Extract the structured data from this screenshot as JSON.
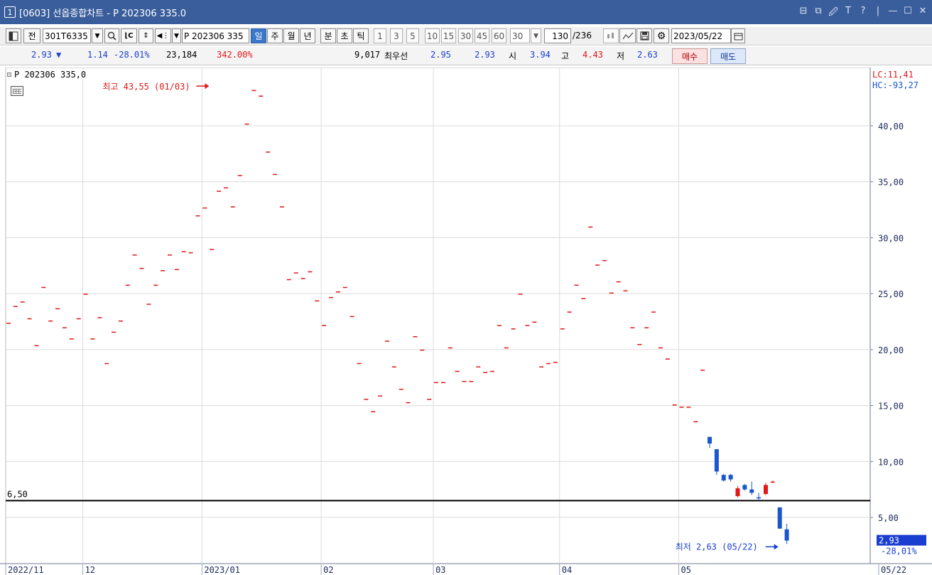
{
  "window": {
    "number": "1",
    "title": "[0603] 선옵종합차트 - P 202306 335.0",
    "controls": [
      "⊟",
      "⧉",
      "🖉",
      "T",
      "?",
      "|",
      "—",
      "☐",
      "✕"
    ]
  },
  "toolbar": {
    "layout_icon": "layout-icon",
    "prev_label": "전",
    "code_value": "301T6335",
    "search_icon": "search-icon",
    "chart_type_icon": "candle-type-icon",
    "updown_icon": "updown-icon",
    "sound_icon": "sound-icon",
    "name_value": "P 202306 335",
    "periods": [
      "일",
      "주",
      "월",
      "년",
      "분",
      "초",
      "틱"
    ],
    "selected_period": "일",
    "intervals": [
      "1",
      "3",
      "5",
      "10",
      "15",
      "30",
      "45",
      "60"
    ],
    "interval_value": "30",
    "count_value": "130",
    "count_total": "/236",
    "date_value": "2023/05/22",
    "tool_icons": [
      "compare-icon",
      "draw-icon",
      "save-icon",
      "gear-icon"
    ],
    "calendar_icon": "calendar-icon"
  },
  "info": {
    "price": "2.93",
    "price_arrow": "▼",
    "change": "1.14",
    "change_pct": "-28.01%",
    "volume": "23,184",
    "volume_pct": "342.00%",
    "open_interest": "9,017",
    "best_label": "최우선",
    "best_ask": "2.95",
    "best_bid": "2.93",
    "open_label": "시",
    "open": "3.94",
    "high_label": "고",
    "high": "4.43",
    "low_label": "저",
    "low": "2.63",
    "buy_label": "매수",
    "sell_label": "매도"
  },
  "chart_data": {
    "type": "candlestick",
    "title": "P 202306 335,0",
    "ylim": [
      0,
      45
    ],
    "y_ticks": [
      "40,00",
      "35,00",
      "30,00",
      "25,00",
      "20,00",
      "15,00",
      "10,00",
      "5,00"
    ],
    "y_tick_values": [
      40,
      35,
      30,
      25,
      20,
      15,
      10,
      5
    ],
    "x_ticks": [
      {
        "label": "2022/11",
        "index": 0
      },
      {
        "label": "12",
        "index": 11
      },
      {
        "label": "2023/01",
        "index": 28
      },
      {
        "label": "02",
        "index": 45
      },
      {
        "label": "03",
        "index": 61
      },
      {
        "label": "04",
        "index": 79
      },
      {
        "label": "05",
        "index": 96
      },
      {
        "label": "05/22",
        "index": 110
      }
    ],
    "hline": {
      "value": 6.5,
      "label": "6,50"
    },
    "lc_label": "LC:11,41",
    "hc_label": "HC:-93,27",
    "current": {
      "value": 2.93,
      "label": "2,93",
      "pct": "-28,01%"
    },
    "max_annotation": {
      "text": "최고 43,55 (01/03)",
      "index": 28,
      "value": 43.55
    },
    "min_annotation": {
      "text": "최저 2,63 (05/22)",
      "index": 110,
      "value": 2.63
    },
    "up_color": "#e01818",
    "down_color": "#1a56d0",
    "candles": [
      {
        "o": 22.4,
        "h": 22.4,
        "l": 22.4,
        "c": 22.4
      },
      {
        "o": 23.9,
        "h": 23.9,
        "l": 23.9,
        "c": 23.9
      },
      {
        "o": 24.3,
        "h": 24.3,
        "l": 24.3,
        "c": 24.3
      },
      {
        "o": 22.8,
        "h": 22.8,
        "l": 22.8,
        "c": 22.8
      },
      {
        "o": 20.4,
        "h": 20.4,
        "l": 20.4,
        "c": 20.4
      },
      {
        "o": 25.6,
        "h": 25.6,
        "l": 25.6,
        "c": 25.6
      },
      {
        "o": 22.6,
        "h": 22.6,
        "l": 22.6,
        "c": 22.6
      },
      {
        "o": 23.7,
        "h": 23.7,
        "l": 23.7,
        "c": 23.7
      },
      {
        "o": 22.0,
        "h": 22.0,
        "l": 22.0,
        "c": 22.0
      },
      {
        "o": 21.0,
        "h": 21.0,
        "l": 21.0,
        "c": 21.0
      },
      {
        "o": 22.8,
        "h": 22.8,
        "l": 22.8,
        "c": 22.8
      },
      {
        "o": 25.0,
        "h": 25.0,
        "l": 25.0,
        "c": 25.0
      },
      {
        "o": 21.0,
        "h": 21.0,
        "l": 21.0,
        "c": 21.0
      },
      {
        "o": 22.9,
        "h": 22.9,
        "l": 22.9,
        "c": 22.9
      },
      {
        "o": 18.8,
        "h": 18.8,
        "l": 18.8,
        "c": 18.8
      },
      {
        "o": 21.6,
        "h": 21.6,
        "l": 21.6,
        "c": 21.6
      },
      {
        "o": 22.6,
        "h": 22.6,
        "l": 22.6,
        "c": 22.6
      },
      {
        "o": 25.8,
        "h": 25.8,
        "l": 25.8,
        "c": 25.8
      },
      {
        "o": 28.5,
        "h": 28.5,
        "l": 28.5,
        "c": 28.5
      },
      {
        "o": 27.3,
        "h": 27.3,
        "l": 27.3,
        "c": 27.3
      },
      {
        "o": 24.1,
        "h": 24.1,
        "l": 24.1,
        "c": 24.1
      },
      {
        "o": 25.8,
        "h": 25.8,
        "l": 25.8,
        "c": 25.8
      },
      {
        "o": 27.1,
        "h": 27.1,
        "l": 27.1,
        "c": 27.1
      },
      {
        "o": 28.5,
        "h": 28.5,
        "l": 28.5,
        "c": 28.5
      },
      {
        "o": 27.2,
        "h": 27.2,
        "l": 27.2,
        "c": 27.2
      },
      {
        "o": 28.8,
        "h": 28.8,
        "l": 28.8,
        "c": 28.8
      },
      {
        "o": 28.7,
        "h": 28.7,
        "l": 28.7,
        "c": 28.7
      },
      {
        "o": 32.0,
        "h": 32.0,
        "l": 32.0,
        "c": 32.0
      },
      {
        "o": 32.7,
        "h": 32.7,
        "l": 32.7,
        "c": 32.7
      },
      {
        "o": 29.0,
        "h": 29.0,
        "l": 29.0,
        "c": 29.0
      },
      {
        "o": 34.2,
        "h": 34.2,
        "l": 34.2,
        "c": 34.2
      },
      {
        "o": 34.5,
        "h": 34.5,
        "l": 34.5,
        "c": 34.5
      },
      {
        "o": 32.8,
        "h": 32.8,
        "l": 32.8,
        "c": 32.8
      },
      {
        "o": 35.6,
        "h": 35.6,
        "l": 35.6,
        "c": 35.6
      },
      {
        "o": 40.2,
        "h": 40.2,
        "l": 40.2,
        "c": 40.2
      },
      {
        "o": 43.2,
        "h": 43.2,
        "l": 43.2,
        "c": 43.2
      },
      {
        "o": 42.7,
        "h": 42.7,
        "l": 42.7,
        "c": 42.7
      },
      {
        "o": 37.7,
        "h": 37.7,
        "l": 37.7,
        "c": 37.7
      },
      {
        "o": 35.7,
        "h": 35.7,
        "l": 35.7,
        "c": 35.7
      },
      {
        "o": 32.8,
        "h": 32.8,
        "l": 32.8,
        "c": 32.8
      },
      {
        "o": 26.3,
        "h": 26.3,
        "l": 26.3,
        "c": 26.3
      },
      {
        "o": 26.9,
        "h": 26.9,
        "l": 26.9,
        "c": 26.9
      },
      {
        "o": 26.4,
        "h": 26.4,
        "l": 26.4,
        "c": 26.4
      },
      {
        "o": 27.0,
        "h": 27.0,
        "l": 27.0,
        "c": 27.0
      },
      {
        "o": 24.4,
        "h": 24.4,
        "l": 24.4,
        "c": 24.4
      },
      {
        "o": 22.2,
        "h": 22.2,
        "l": 22.2,
        "c": 22.2
      },
      {
        "o": 24.7,
        "h": 24.7,
        "l": 24.7,
        "c": 24.7
      },
      {
        "o": 25.2,
        "h": 25.2,
        "l": 25.2,
        "c": 25.2
      },
      {
        "o": 25.6,
        "h": 25.6,
        "l": 25.6,
        "c": 25.6
      },
      {
        "o": 23.0,
        "h": 23.0,
        "l": 23.0,
        "c": 23.0
      },
      {
        "o": 18.8,
        "h": 18.8,
        "l": 18.8,
        "c": 18.8
      },
      {
        "o": 15.6,
        "h": 15.6,
        "l": 15.6,
        "c": 15.6
      },
      {
        "o": 14.5,
        "h": 14.5,
        "l": 14.5,
        "c": 14.5
      },
      {
        "o": 15.9,
        "h": 15.9,
        "l": 15.9,
        "c": 15.9
      },
      {
        "o": 20.8,
        "h": 20.8,
        "l": 20.8,
        "c": 20.8
      },
      {
        "o": 18.5,
        "h": 18.5,
        "l": 18.5,
        "c": 18.5
      },
      {
        "o": 16.5,
        "h": 16.5,
        "l": 16.5,
        "c": 16.5
      },
      {
        "o": 15.3,
        "h": 15.3,
        "l": 15.3,
        "c": 15.3
      },
      {
        "o": 21.2,
        "h": 21.2,
        "l": 21.2,
        "c": 21.2
      },
      {
        "o": 20.0,
        "h": 20.0,
        "l": 20.0,
        "c": 20.0
      },
      {
        "o": 15.6,
        "h": 15.6,
        "l": 15.6,
        "c": 15.6
      },
      {
        "o": 17.1,
        "h": 17.1,
        "l": 17.1,
        "c": 17.1
      },
      {
        "o": 17.1,
        "h": 17.1,
        "l": 17.1,
        "c": 17.1
      },
      {
        "o": 20.2,
        "h": 20.2,
        "l": 20.2,
        "c": 20.2
      },
      {
        "o": 18.1,
        "h": 18.1,
        "l": 18.1,
        "c": 18.1
      },
      {
        "o": 17.2,
        "h": 17.2,
        "l": 17.2,
        "c": 17.2
      },
      {
        "o": 17.2,
        "h": 17.2,
        "l": 17.2,
        "c": 17.2
      },
      {
        "o": 18.5,
        "h": 18.5,
        "l": 18.5,
        "c": 18.5
      },
      {
        "o": 18.0,
        "h": 18.0,
        "l": 18.0,
        "c": 18.0
      },
      {
        "o": 18.1,
        "h": 18.1,
        "l": 18.1,
        "c": 18.1
      },
      {
        "o": 22.2,
        "h": 22.2,
        "l": 22.2,
        "c": 22.2
      },
      {
        "o": 20.2,
        "h": 20.2,
        "l": 20.2,
        "c": 20.2
      },
      {
        "o": 21.9,
        "h": 21.9,
        "l": 21.9,
        "c": 21.9
      },
      {
        "o": 25.0,
        "h": 25.0,
        "l": 25.0,
        "c": 25.0
      },
      {
        "o": 22.2,
        "h": 22.2,
        "l": 22.2,
        "c": 22.2
      },
      {
        "o": 22.5,
        "h": 22.5,
        "l": 22.5,
        "c": 22.5
      },
      {
        "o": 18.5,
        "h": 18.5,
        "l": 18.5,
        "c": 18.5
      },
      {
        "o": 18.8,
        "h": 18.8,
        "l": 18.8,
        "c": 18.8
      },
      {
        "o": 18.9,
        "h": 18.9,
        "l": 18.9,
        "c": 18.9
      },
      {
        "o": 21.9,
        "h": 21.9,
        "l": 21.9,
        "c": 21.9
      },
      {
        "o": 23.4,
        "h": 23.4,
        "l": 23.4,
        "c": 23.4
      },
      {
        "o": 25.8,
        "h": 25.8,
        "l": 25.8,
        "c": 25.8
      },
      {
        "o": 24.6,
        "h": 24.6,
        "l": 24.6,
        "c": 24.6
      },
      {
        "o": 31.0,
        "h": 31.0,
        "l": 31.0,
        "c": 31.0
      },
      {
        "o": 27.6,
        "h": 27.6,
        "l": 27.6,
        "c": 27.6
      },
      {
        "o": 28.0,
        "h": 28.0,
        "l": 28.0,
        "c": 28.0
      },
      {
        "o": 25.1,
        "h": 25.1,
        "l": 25.1,
        "c": 25.1
      },
      {
        "o": 26.1,
        "h": 26.1,
        "l": 26.1,
        "c": 26.1
      },
      {
        "o": 25.3,
        "h": 25.3,
        "l": 25.3,
        "c": 25.3
      },
      {
        "o": 22.0,
        "h": 22.0,
        "l": 22.0,
        "c": 22.0
      },
      {
        "o": 20.5,
        "h": 20.5,
        "l": 20.5,
        "c": 20.5
      },
      {
        "o": 22.0,
        "h": 22.0,
        "l": 22.0,
        "c": 22.0
      },
      {
        "o": 23.4,
        "h": 23.4,
        "l": 23.4,
        "c": 23.4
      },
      {
        "o": 20.2,
        "h": 20.2,
        "l": 20.2,
        "c": 20.2
      },
      {
        "o": 19.2,
        "h": 19.2,
        "l": 19.2,
        "c": 19.2
      },
      {
        "o": 15.1,
        "h": 15.1,
        "l": 15.1,
        "c": 15.1
      },
      {
        "o": 14.9,
        "h": 14.9,
        "l": 14.9,
        "c": 14.9
      },
      {
        "o": 14.9,
        "h": 14.9,
        "l": 14.9,
        "c": 14.9
      },
      {
        "o": 13.6,
        "h": 13.6,
        "l": 13.6,
        "c": 13.6
      },
      {
        "o": 18.2,
        "h": 18.2,
        "l": 18.2,
        "c": 18.2
      },
      {
        "o": 12.2,
        "h": 12.2,
        "l": 11.2,
        "c": 11.6
      },
      {
        "o": 11.1,
        "h": 11.1,
        "l": 8.8,
        "c": 9.1
      },
      {
        "o": 8.8,
        "h": 8.9,
        "l": 8.2,
        "c": 8.3
      },
      {
        "o": 8.8,
        "h": 8.9,
        "l": 8.2,
        "c": 8.4
      },
      {
        "o": 6.9,
        "h": 7.8,
        "l": 6.8,
        "c": 7.6
      },
      {
        "o": 7.9,
        "h": 8.0,
        "l": 7.4,
        "c": 7.5
      },
      {
        "o": 7.5,
        "h": 8.2,
        "l": 7.0,
        "c": 7.2
      },
      {
        "o": 6.8,
        "h": 7.2,
        "l": 6.5,
        "c": 6.7
      },
      {
        "o": 7.1,
        "h": 8.1,
        "l": 7.0,
        "c": 7.9
      },
      {
        "o": 8.2,
        "h": 8.3,
        "l": 8.1,
        "c": 8.2
      }
    ]
  }
}
